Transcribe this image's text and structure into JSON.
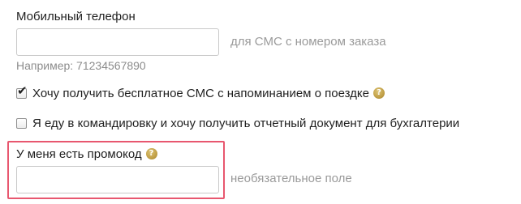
{
  "phone": {
    "label": "Мобильный телефон",
    "value": "",
    "placeholder": "",
    "hint": "для СМС с номером заказа",
    "example": "Например: 71234567890"
  },
  "reminder_sms": {
    "label": "Хочу получить бесплатное СМС с напоминанием о поездке",
    "checked": true,
    "help_icon": "question-icon"
  },
  "business_trip": {
    "label": "Я еду в командировку и хочу получить отчетный документ для бухгалтерии",
    "checked": false
  },
  "promo": {
    "label": "У меня есть промокод",
    "help_icon": "question-icon",
    "value": "",
    "placeholder": "",
    "hint": "необязательное поле",
    "highlight_color": "#e8576f"
  },
  "colors": {
    "text": "#1f1f1f",
    "muted": "#9a9a9a",
    "help_icon": "#c3a24a",
    "highlight": "#e8576f"
  }
}
